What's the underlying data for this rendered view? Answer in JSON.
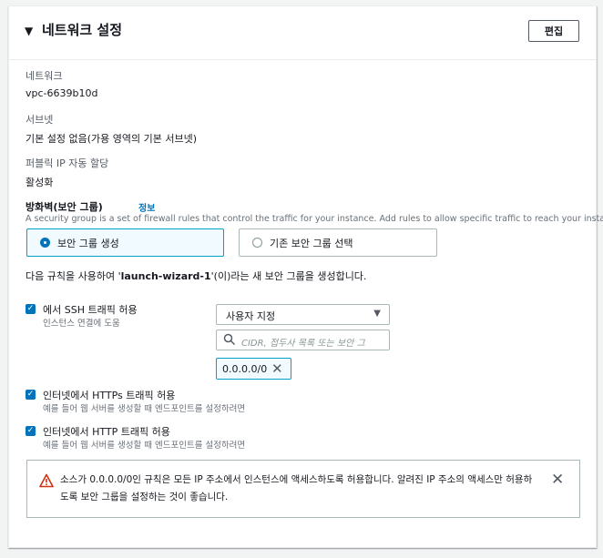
{
  "header": {
    "title": "네트워크 설정",
    "edit_label": "편집"
  },
  "network": {
    "label": "네트워크",
    "value": "vpc-6639b10d"
  },
  "subnet": {
    "label": "서브넷",
    "value": "기본 설정 없음(가용 영역의 기본 서브넷)"
  },
  "public_ip": {
    "label": "퍼블릭 IP 자동 할당",
    "value": "활성화"
  },
  "firewall": {
    "title": "방화벽(보안 그룹)",
    "info_link": "정보",
    "description": "A security group is a set of firewall rules that control the traffic for your instance. Add rules to allow specific traffic to reach your instance.",
    "options": [
      {
        "label": "보안 그룹 생성",
        "selected": true
      },
      {
        "label": "기존 보안 그룹 선택",
        "selected": false
      }
    ],
    "rule_prefix": "다음 규칙을 사용하여 '",
    "rule_name": "launch-wizard-1",
    "rule_suffix": "'(이)라는 새 보안 그룹을 생성합니다."
  },
  "rules": [
    {
      "label": "에서 SSH 트래픽 허용",
      "description": "인스턴스 연결에 도움",
      "checked": true
    },
    {
      "label": "인터넷에서 HTTPs 트래픽 허용",
      "description": "예를 들어 웹 서버를 생성할 때 엔드포인트를 설정하려면",
      "checked": true
    },
    {
      "label": "인터넷에서 HTTP 트래픽 허용",
      "description": "예를 들어 웹 서버를 생성할 때 엔드포인트를 설정하려면",
      "checked": true
    }
  ],
  "ssh_source": {
    "selected": "사용자 지정",
    "search_placeholder": "CIDR, 접두사 목록 또는 보안 그",
    "token": "0.0.0.0/0"
  },
  "alert": {
    "text": "소스가 0.0.0.0/0인 규칙은 모든 IP 주소에서 인스턴스에 액세스하도록 허용합니다. 알려진 IP 주소의 액세스만 허용하도록 보안 그룹을 설정하는 것이 좋습니다."
  },
  "colors": {
    "accent": "#0073bb",
    "selected_border": "#00a1c9",
    "warning": "#d13212"
  }
}
